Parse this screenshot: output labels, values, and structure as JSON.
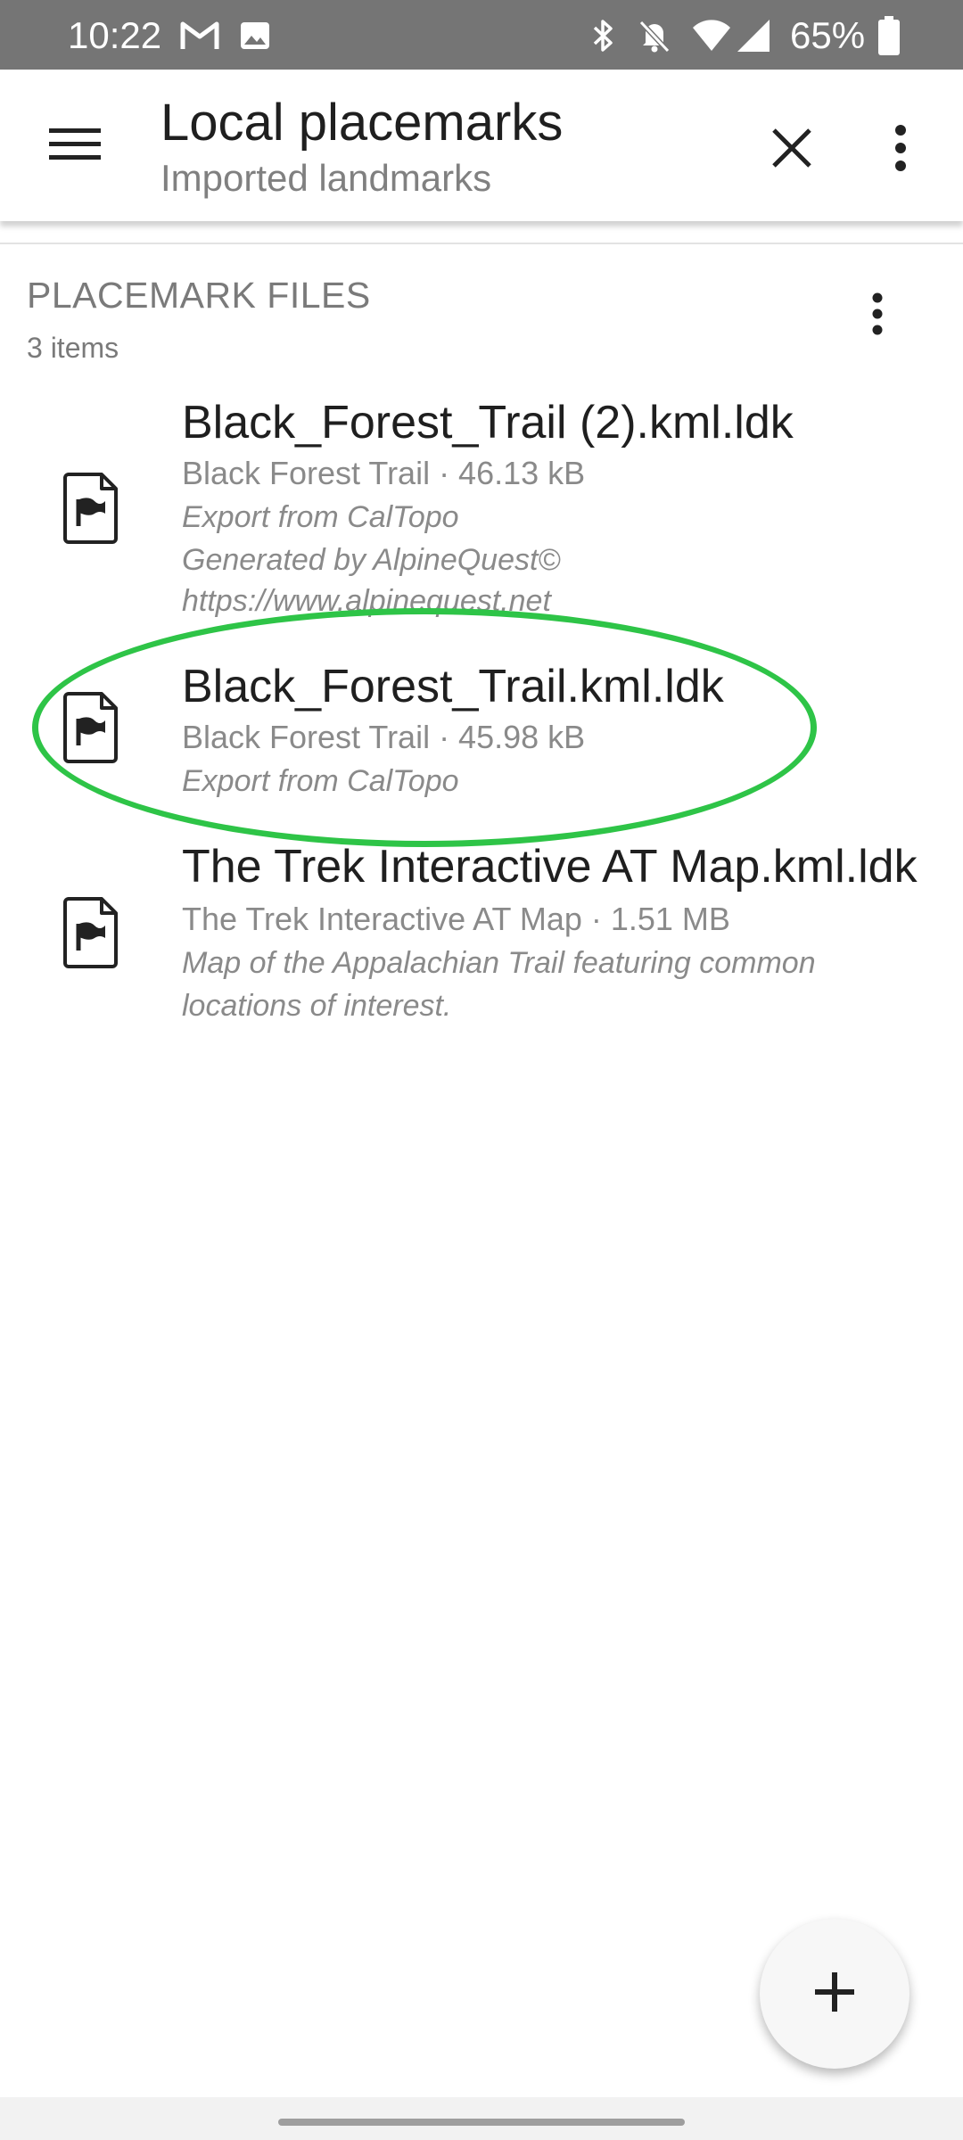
{
  "status_bar": {
    "time": "10:22",
    "battery": "65%",
    "icons": [
      "gmail-icon",
      "image-icon",
      "bluetooth-icon",
      "mute-icon",
      "wifi-icon",
      "signal-icon",
      "battery-icon"
    ]
  },
  "app_bar": {
    "title": "Local placemarks",
    "subtitle": "Imported landmarks",
    "icons": [
      "menu-icon",
      "close-icon",
      "more-vert-icon"
    ]
  },
  "section": {
    "title": "PLACEMARK FILES",
    "count": "3 items"
  },
  "files": [
    {
      "name": "Black_Forest_Trail (2).kml.ldk",
      "meta": "Black Forest Trail · 46.13 kB",
      "desc": [
        "Export from CalTopo",
        "Generated by AlpineQuest©",
        "https://www.alpinequest.net"
      ]
    },
    {
      "name": "Black_Forest_Trail.kml.ldk",
      "meta": "Black Forest Trail · 45.98 kB",
      "desc": [
        "Export from CalTopo"
      ]
    },
    {
      "name": "The Trek Interactive AT Map.kml.ldk",
      "meta": "The Trek Interactive AT Map · 1.51 MB",
      "desc": [
        "Map of the Appalachian Trail featuring common",
        "locations of interest."
      ]
    }
  ],
  "fab": {
    "icon": "plus-icon"
  },
  "colors": {
    "status_bar": "#757575",
    "highlight": "#2ec447",
    "secondary_text": "#8a8a8a"
  }
}
